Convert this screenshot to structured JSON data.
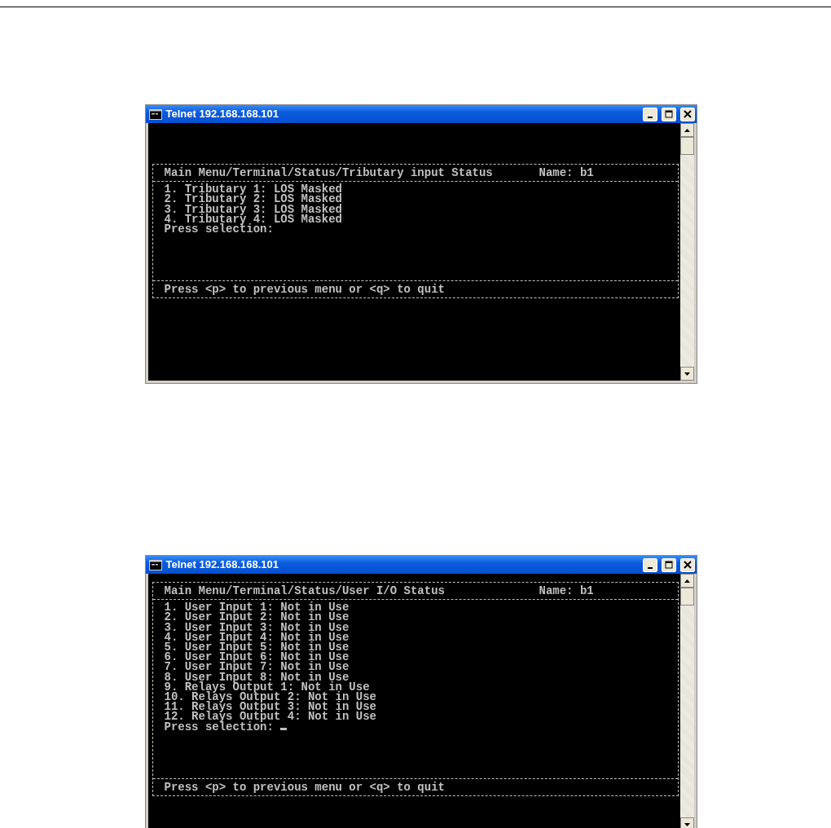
{
  "windows": [
    {
      "title": "Telnet 192.168.168.101",
      "header": {
        "path": "Main Menu/Terminal/Status/Tributary input Status",
        "name": "Name: b1"
      },
      "lines": [
        "1. Tributary 1: LOS Masked",
        "2. Tributary 2: LOS Masked",
        "3. Tributary 3: LOS Masked",
        "4. Tributary 4: LOS Masked"
      ],
      "prompt": "Press selection:",
      "cursor": false,
      "footer": "Press <p> to previous menu or <q> to quit"
    },
    {
      "title": "Telnet 192.168.168.101",
      "header": {
        "path": "Main Menu/Terminal/Status/User I/O Status",
        "name": "Name: b1"
      },
      "lines": [
        "1. User Input 1: Not in Use",
        "2. User Input 2: Not in Use",
        "3. User Input 3: Not in Use",
        "4. User Input 4: Not in Use",
        "5. User Input 5: Not in Use",
        "6. User Input 6: Not in Use",
        "7. User Input 7: Not in Use",
        "8. User Input 8: Not in Use",
        "9. Relays Output 1: Not in Use",
        "10. Relays Output 2: Not in Use",
        "11. Relays Output 3: Not in Use",
        "12. Relays Output 4: Not in Use"
      ],
      "prompt": "Press selection:",
      "cursor": true,
      "footer": "Press <p> to previous menu or <q> to quit"
    }
  ]
}
